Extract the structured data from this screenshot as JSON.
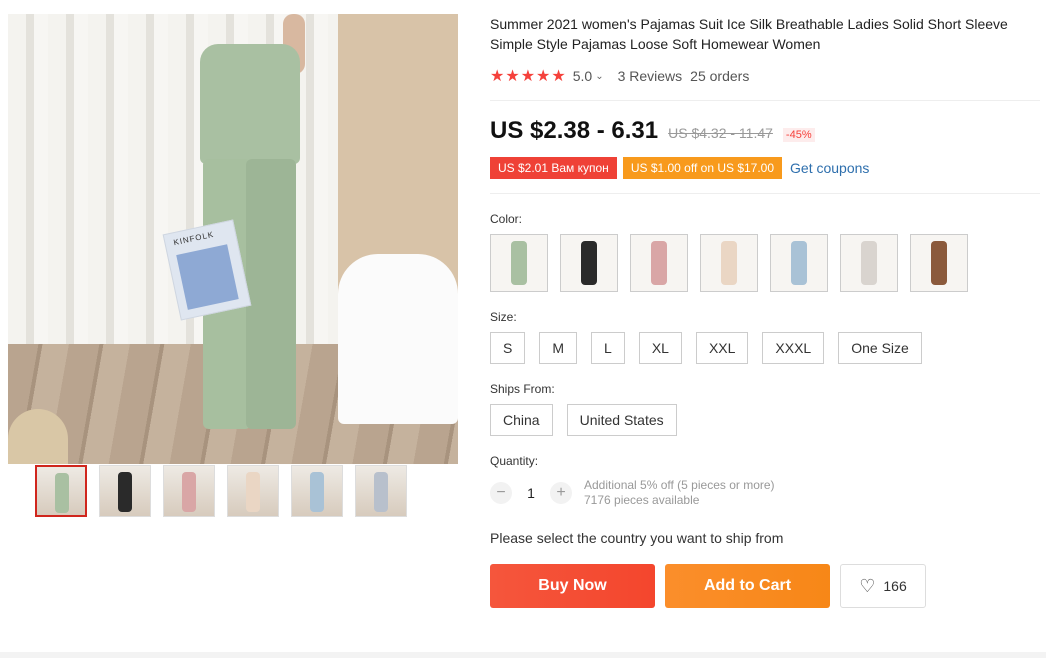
{
  "product": {
    "title": "Summer 2021 women's Pajamas Suit Ice Silk Breathable Ladies Solid Short Sleeve Simple Style Pajamas Loose Soft Homewear Women",
    "stars": "★★★★★",
    "rating": "5.0",
    "rating_caret": "⌄",
    "reviews": "3 Reviews",
    "orders": "25 orders"
  },
  "price": {
    "current": "US $2.38 - 6.31",
    "original": "US $4.32 - 11.47",
    "discount": "-45%"
  },
  "coupons": {
    "coupon1": "US $2.01 Вам купон",
    "coupon2": "US $1.00 off on US $17.00",
    "get_link": "Get coupons"
  },
  "color": {
    "label": "Color:",
    "swatch_colors": [
      "#a9c0a2",
      "#2a2a2a",
      "#d9a6a6",
      "#ead6c4",
      "#a9c2d6",
      "#d9d4cf",
      "#8b5a3c"
    ]
  },
  "size": {
    "label": "Size:",
    "options": [
      "S",
      "M",
      "L",
      "XL",
      "XXL",
      "XXXL",
      "One Size"
    ]
  },
  "ships_from": {
    "label": "Ships From:",
    "options": [
      "China",
      "United States"
    ]
  },
  "quantity": {
    "label": "Quantity:",
    "minus": "−",
    "value": "1",
    "plus": "+",
    "note_line1": "Additional 5% off (5 pieces or more)",
    "note_line2": "7176 pieces available"
  },
  "ship_notice": "Please select the country you want to ship from",
  "actions": {
    "buy_now": "Buy Now",
    "add_to_cart": "Add to Cart",
    "wishlist_icon": "heart-icon",
    "wishlist_count": "166"
  },
  "gallery": {
    "magazine_text": "KINFOLK",
    "thumb_colors": [
      "#a9c0a2",
      "#2a2a2a",
      "#d9a6a6",
      "#ead6c4",
      "#a9c2d6",
      "#b8c0cc"
    ]
  },
  "colors": {
    "accent_red": "#f5413b",
    "buy_button": "#f4462d",
    "cart_button": "#f78717",
    "link_blue": "#2e6fad"
  }
}
